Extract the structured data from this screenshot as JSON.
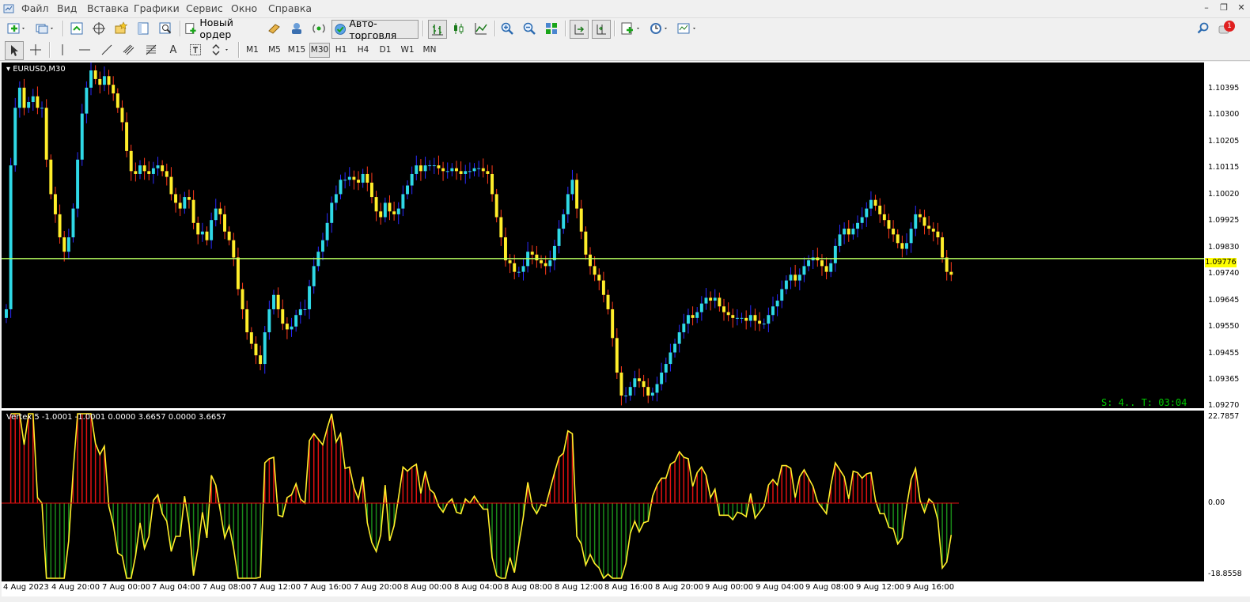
{
  "menu": {
    "items": [
      "Файл",
      "Вид",
      "Вставка",
      "Графики",
      "Сервис",
      "Окно",
      "Справка"
    ]
  },
  "window_controls": [
    "–",
    "❐",
    "✕"
  ],
  "toolbar": {
    "new_order_label": "Новый ордер",
    "auto_trading_label": "Авто-торговля",
    "notification_count": "1"
  },
  "timeframes": [
    "M1",
    "M5",
    "M15",
    "M30",
    "H1",
    "H4",
    "D1",
    "W1",
    "MN"
  ],
  "active_timeframe": "M30",
  "chart": {
    "symbol_title": "EURUSD,M30",
    "current_price": "1.09776",
    "timer_text": "S: 4.. T: 03:04",
    "price_axis": [
      "1.10395",
      "1.10300",
      "1.10205",
      "1.10115",
      "1.10020",
      "1.09925",
      "1.09830",
      "1.09740",
      "1.09645",
      "1.09550",
      "1.09455",
      "1.09365",
      "1.09270"
    ],
    "time_axis": [
      "4 Aug 2023",
      "4 Aug 20:00",
      "7 Aug 00:00",
      "7 Aug 04:00",
      "7 Aug 08:00",
      "7 Aug 12:00",
      "7 Aug 16:00",
      "7 Aug 20:00",
      "8 Aug 00:00",
      "8 Aug 04:00",
      "8 Aug 08:00",
      "8 Aug 12:00",
      "8 Aug 16:00",
      "8 Aug 20:00",
      "9 Aug 00:00",
      "9 Aug 04:00",
      "9 Aug 08:00",
      "9 Aug 12:00",
      "9 Aug 16:00"
    ],
    "colors": {
      "bull": "#2fd9e6",
      "bear": "#ffee2a",
      "wick_bull": "#2a2aff",
      "wick_bear": "#ff3a1a",
      "price_line": "#b8ff60"
    }
  },
  "indicator": {
    "title": "Vertex 5 -1.0001 -1.0001 0.0000 3.6657 0.0000 3.6657",
    "scale": [
      "22.7857",
      "0.00",
      "-18.8558"
    ],
    "colors": {
      "up": "#e01010",
      "down": "#1a8a1a",
      "line": "#ffee2a"
    }
  },
  "chart_data": {
    "type": "candlestick",
    "symbol": "EURUSD",
    "timeframe": "M30",
    "ylim": [
      1.0927,
      1.1043
    ],
    "close": [
      1.096,
      1.101,
      1.103,
      1.1037,
      1.103,
      1.1032,
      1.1034,
      1.103,
      1.103,
      1.1012,
      1.1,
      1.0993,
      1.0985,
      1.098,
      1.0985,
      1.0995,
      1.1012,
      1.1028,
      1.1037,
      1.1043,
      1.104,
      1.1038,
      1.1041,
      1.1038,
      1.1035,
      1.103,
      1.1025,
      1.1015,
      1.1008,
      1.1007,
      1.101,
      1.1008,
      1.1007,
      1.1009,
      1.101,
      1.1008,
      1.1006,
      1.1,
      1.0997,
      1.0995,
      1.0999,
      1.0998,
      1.099,
      1.0986,
      1.0987,
      1.0984,
      1.0991,
      1.0995,
      1.0993,
      1.0987,
      1.0984,
      1.0978,
      1.0967,
      1.096,
      1.0952,
      1.0948,
      1.0944,
      1.0941,
      1.0952,
      1.096,
      1.0965,
      1.096,
      1.0955,
      1.0953,
      1.0954,
      1.0958,
      1.096,
      1.096,
      1.0968,
      1.0975,
      1.098,
      1.0984,
      1.099,
      1.0997,
      1.1,
      1.1005,
      1.1005,
      1.1006,
      1.1005,
      1.1004,
      1.1007,
      1.1004,
      1.0999,
      1.0994,
      1.0992,
      1.0997,
      1.0994,
      1.0993,
      1.0995,
      1.1,
      1.1003,
      1.1007,
      1.101,
      1.1008,
      1.101,
      1.101,
      1.101,
      1.1009,
      1.1008,
      1.1008,
      1.1009,
      1.1008,
      1.1007,
      1.1008,
      1.1008,
      1.1009,
      1.1009,
      1.1008,
      1.1007,
      1.1,
      1.0992,
      1.0985,
      1.0977,
      1.0976,
      1.0973,
      1.0973,
      1.0975,
      1.098,
      1.0979,
      1.0977,
      1.0976,
      1.0975,
      1.0977,
      1.0982,
      1.0988,
      1.0993,
      1.1,
      1.1005,
      1.0995,
      1.0987,
      1.0979,
      1.0975,
      1.0972,
      1.097,
      1.0965,
      1.096,
      1.095,
      1.0938,
      1.093,
      1.093,
      1.0933,
      1.0936,
      1.0935,
      1.0933,
      1.093,
      1.0931,
      1.0934,
      1.0938,
      1.0941,
      1.0945,
      1.0948,
      1.0952,
      1.0955,
      1.0958,
      1.0957,
      1.0959,
      1.0962,
      1.0964,
      1.0963,
      1.0964,
      1.0961,
      1.0959,
      1.0958,
      1.0957,
      1.0957,
      1.0957,
      1.0956,
      1.0958,
      1.0956,
      1.0955,
      1.0955,
      1.0958,
      1.0961,
      1.0963,
      1.0967,
      1.097,
      1.0972,
      1.097,
      1.0972,
      1.0975,
      1.0977,
      1.0978,
      1.0977,
      1.0975,
      1.0973,
      1.0976,
      1.0982,
      1.0986,
      1.0988,
      1.0986,
      1.0988,
      1.099,
      1.0992,
      1.0995,
      1.0998,
      1.0996,
      1.0993,
      1.0991,
      1.0988,
      1.0986,
      1.0983,
      1.0981,
      1.0983,
      1.0988,
      1.0993,
      1.0992,
      1.0989,
      1.0988,
      1.0987,
      1.0985,
      1.0978,
      1.0973,
      1.0972
    ]
  }
}
